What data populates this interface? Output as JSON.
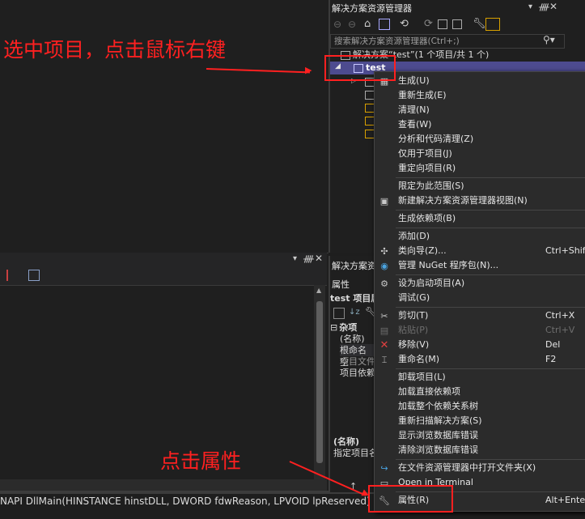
{
  "solution_explorer": {
    "title": "解决方案资源管理器",
    "search_placeholder": "搜索解决方案资源管理器(Ctrl+;)",
    "solution_node": "解决方案“test”(1 个项目/共 1 个)",
    "project_node": "test"
  },
  "properties": {
    "pane_title": "解决方案资",
    "header": "属性",
    "project_line": "test 项目属",
    "category": "杂项",
    "rows": [
      "(名称)",
      "根命名空",
      "项目文件",
      "项目依赖"
    ],
    "desc_title": "(名称)",
    "desc_text": "指定项目名"
  },
  "context_menu": {
    "items": [
      {
        "label": "生成(U)",
        "shortcut": "",
        "icon": "build-icon",
        "disabled": false
      },
      {
        "label": "重新生成(E)",
        "shortcut": "",
        "icon": "",
        "disabled": false
      },
      {
        "label": "清理(N)",
        "shortcut": "",
        "icon": "",
        "disabled": false
      },
      {
        "label": "查看(W)",
        "shortcut": "",
        "icon": "",
        "disabled": false
      },
      {
        "label": "分析和代码清理(Z)",
        "shortcut": "",
        "icon": "",
        "disabled": false
      },
      {
        "label": "仅用于项目(J)",
        "shortcut": "",
        "icon": "",
        "disabled": false
      },
      {
        "label": "重定向项目(R)",
        "shortcut": "",
        "icon": "",
        "disabled": false
      },
      {
        "label": "限定为此范围(S)",
        "shortcut": "",
        "icon": "",
        "disabled": false
      },
      {
        "label": "新建解决方案资源管理器视图(N)",
        "shortcut": "",
        "icon": "new-view-icon",
        "disabled": false
      },
      {
        "label": "生成依赖项(B)",
        "shortcut": "",
        "icon": "",
        "disabled": false
      },
      {
        "label": "添加(D)",
        "shortcut": "",
        "icon": "",
        "disabled": false
      },
      {
        "label": "类向导(Z)...",
        "shortcut": "Ctrl+Shift+",
        "icon": "class-wizard-icon",
        "disabled": false
      },
      {
        "label": "管理 NuGet 程序包(N)...",
        "shortcut": "",
        "icon": "nuget-icon",
        "disabled": false
      },
      {
        "label": "设为启动项目(A)",
        "shortcut": "",
        "icon": "gear-icon",
        "disabled": false
      },
      {
        "label": "调试(G)",
        "shortcut": "",
        "icon": "",
        "disabled": false
      },
      {
        "label": "剪切(T)",
        "shortcut": "Ctrl+X",
        "icon": "scissors-icon",
        "disabled": false
      },
      {
        "label": "粘贴(P)",
        "shortcut": "Ctrl+V",
        "icon": "paste-icon",
        "disabled": true
      },
      {
        "label": "移除(V)",
        "shortcut": "Del",
        "icon": "remove-icon",
        "disabled": false
      },
      {
        "label": "重命名(M)",
        "shortcut": "F2",
        "icon": "rename-icon",
        "disabled": false
      },
      {
        "label": "卸载项目(L)",
        "shortcut": "",
        "icon": "",
        "disabled": false
      },
      {
        "label": "加载直接依赖项",
        "shortcut": "",
        "icon": "",
        "disabled": false
      },
      {
        "label": "加载整个依赖关系树",
        "shortcut": "",
        "icon": "",
        "disabled": false
      },
      {
        "label": "重新扫描解决方案(S)",
        "shortcut": "",
        "icon": "",
        "disabled": false
      },
      {
        "label": "显示浏览数据库错误",
        "shortcut": "",
        "icon": "",
        "disabled": false
      },
      {
        "label": "清除浏览数据库错误",
        "shortcut": "",
        "icon": "",
        "disabled": false
      },
      {
        "label": "在文件资源管理器中打开文件夹(X)",
        "shortcut": "",
        "icon": "open-folder-icon",
        "disabled": false
      },
      {
        "label": "Open in Terminal",
        "shortcut": "",
        "icon": "terminal-icon",
        "disabled": false
      },
      {
        "label": "属性(R)",
        "shortcut": "Alt+Enter",
        "icon": "wrench-icon",
        "disabled": false
      }
    ]
  },
  "code_line": "NAPI DllMain(HINSTANCE hinstDLL, DWORD fdwReason, LPVOID lpReserved) {",
  "annotations": {
    "select_project": "选中项目，点击鼠标右键",
    "click_properties": "点击属性"
  },
  "colors": {
    "annotation_red": "#ff2020",
    "selection": "#4d4b8f",
    "menu_bg": "#2b2b2b",
    "status_bar": "#007acc"
  }
}
